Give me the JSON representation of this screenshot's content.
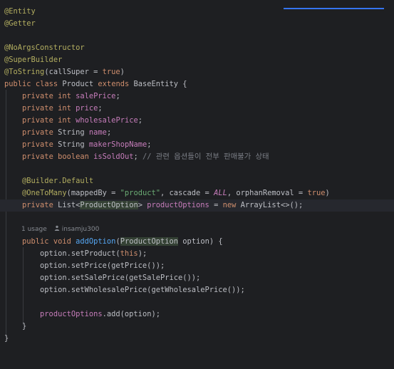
{
  "editor": {
    "lines": {
      "entity": "@Entity",
      "getter": "@Getter",
      "no_args": "@NoArgsConstructor",
      "super_builder": "@SuperBuilder",
      "to_string": {
        "ann": "@ToString",
        "open": "(callSuper = ",
        "val": "true",
        "close": ")"
      },
      "class_decl": {
        "public": "public",
        "cls": "class",
        "name": "Product",
        "extends": "extends",
        "base": "BaseEntity {"
      },
      "f1": {
        "mod": "private",
        "type": "int",
        "name": "salePrice",
        "end": ";"
      },
      "f2": {
        "mod": "private",
        "type": "int",
        "name": "price",
        "end": ";"
      },
      "f3": {
        "mod": "private",
        "type": "int",
        "name": "wholesalePrice",
        "end": ";"
      },
      "f4": {
        "mod": "private",
        "type": "String",
        "name": "name",
        "end": ";"
      },
      "f5": {
        "mod": "private",
        "type": "String",
        "name": "makerShopName",
        "end": ";"
      },
      "f6": {
        "mod": "private",
        "type": "boolean",
        "name": "isSoldOut",
        "end": ";",
        "comment": "// 관련 옵션들이 전부 판매불가 상태"
      },
      "builder_default": "@Builder.Default",
      "one_to_many": {
        "ann": "@OneToMany",
        "p1": "(mappedBy = ",
        "str": "\"product\"",
        "p2": ", cascade = ",
        "all": "ALL",
        "p3": ", orphanRemoval = ",
        "val": "true",
        "p4": ")"
      },
      "options_field": {
        "mod": "private",
        "type1": "List<",
        "type2": "ProductOption",
        "type3": ">",
        "name": "productOptions",
        "eq": " = ",
        "new": "new",
        "rest": " ArrayList<>();"
      },
      "usage": {
        "count": "1 usage",
        "author": "insamju300"
      },
      "add_option": {
        "public": "public",
        "void": "void",
        "name": "addOption",
        "open": "(",
        "ptype": "ProductOption",
        "rest": " option) {"
      },
      "b1": {
        "pre": "option.setProduct(",
        "this": "this",
        "post": ");"
      },
      "b2": "option.setPrice(getPrice());",
      "b3": "option.setSalePrice(getSalePrice());",
      "b4": "option.setWholesalePrice(getWholesalePrice());",
      "b5": {
        "field": "productOptions",
        "rest": ".add(option);"
      },
      "close_method": "}",
      "close_class": "}"
    }
  }
}
